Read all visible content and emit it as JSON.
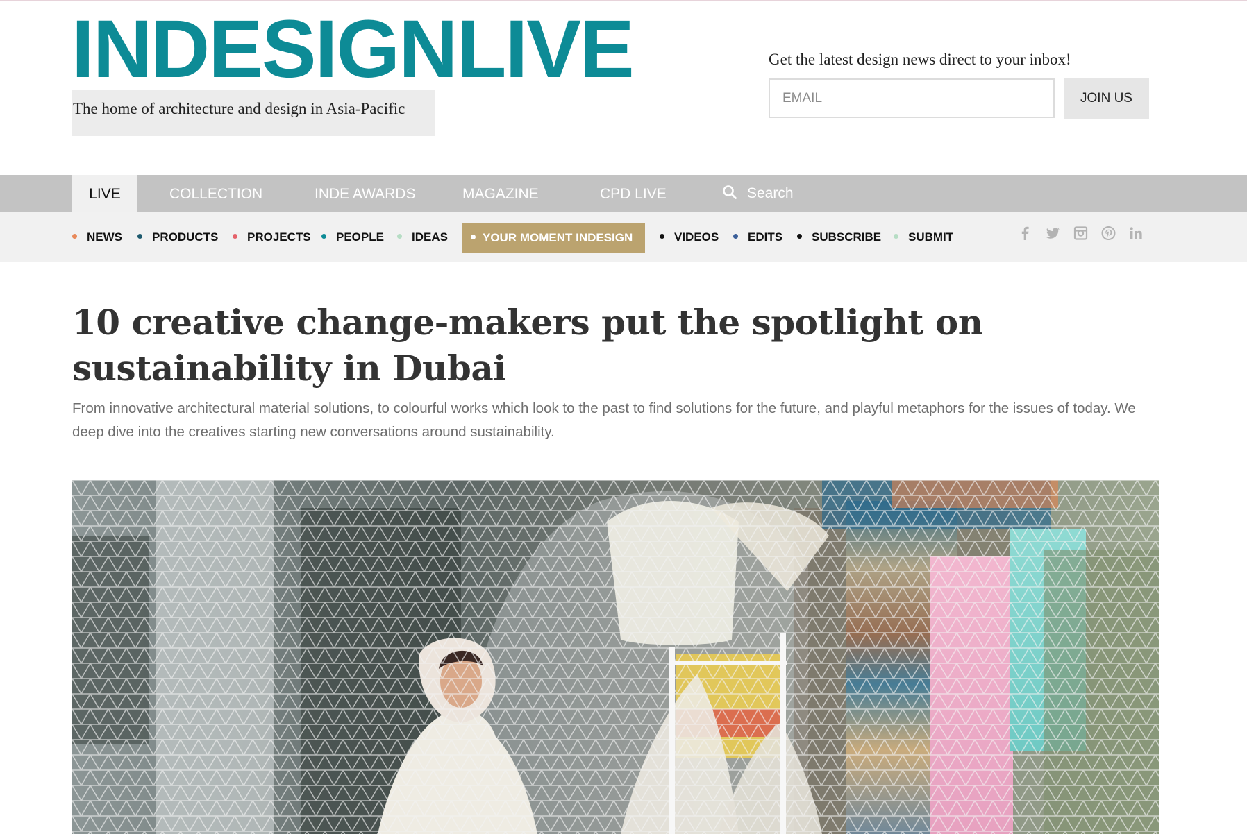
{
  "brand": {
    "logo_text": "INDESIGNLIVE",
    "tagline": "The home of architecture and design in Asia-Pacific",
    "accent_color": "#0d8b96"
  },
  "newsletter": {
    "prompt": "Get the latest design news direct to your inbox!",
    "email_placeholder": "EMAIL",
    "join_label": "JOIN US"
  },
  "main_nav": {
    "tabs": [
      {
        "label": "LIVE",
        "active": true
      },
      {
        "label": "COLLECTION",
        "active": false
      },
      {
        "label": "INDE AWARDS",
        "active": false
      },
      {
        "label": "MAGAZINE",
        "active": false
      },
      {
        "label": "CPD LIVE",
        "active": false
      }
    ],
    "search_label": "Search",
    "search_icon": "search-icon"
  },
  "sub_nav": {
    "items": [
      {
        "label": "NEWS",
        "dot_color": "#e8895a"
      },
      {
        "label": "PRODUCTS",
        "dot_color": "#1d5a6e"
      },
      {
        "label": "PROJECTS",
        "dot_color": "#e5626a"
      },
      {
        "label": "PEOPLE",
        "dot_color": "#0d8b96"
      },
      {
        "label": "IDEAS",
        "dot_color": "#b6ddc4"
      },
      {
        "label": "YOUR MOMENT INDESIGN",
        "dot_color": "#ffffff",
        "highlight_color": "#bba36f"
      },
      {
        "label": "VIDEOS",
        "dot_color": "#111111"
      },
      {
        "label": "EDITS",
        "dot_color": "#3b5f99"
      },
      {
        "label": "SUBSCRIBE",
        "dot_color": "#111111"
      },
      {
        "label": "SUBMIT",
        "dot_color": "#b6ddc4"
      }
    ]
  },
  "social": [
    "facebook-icon",
    "twitter-icon",
    "instagram-icon",
    "pinterest-icon",
    "linkedin-icon"
  ],
  "article": {
    "headline": "10 creative change-makers put the spotlight on sustainability in Dubai",
    "standfirst": "From innovative architectural material solutions, to colourful works which look to the past to find solutions for the future, and playful metaphors for the issues of today. We deep dive into the creatives starting new conversations around sustainability."
  }
}
